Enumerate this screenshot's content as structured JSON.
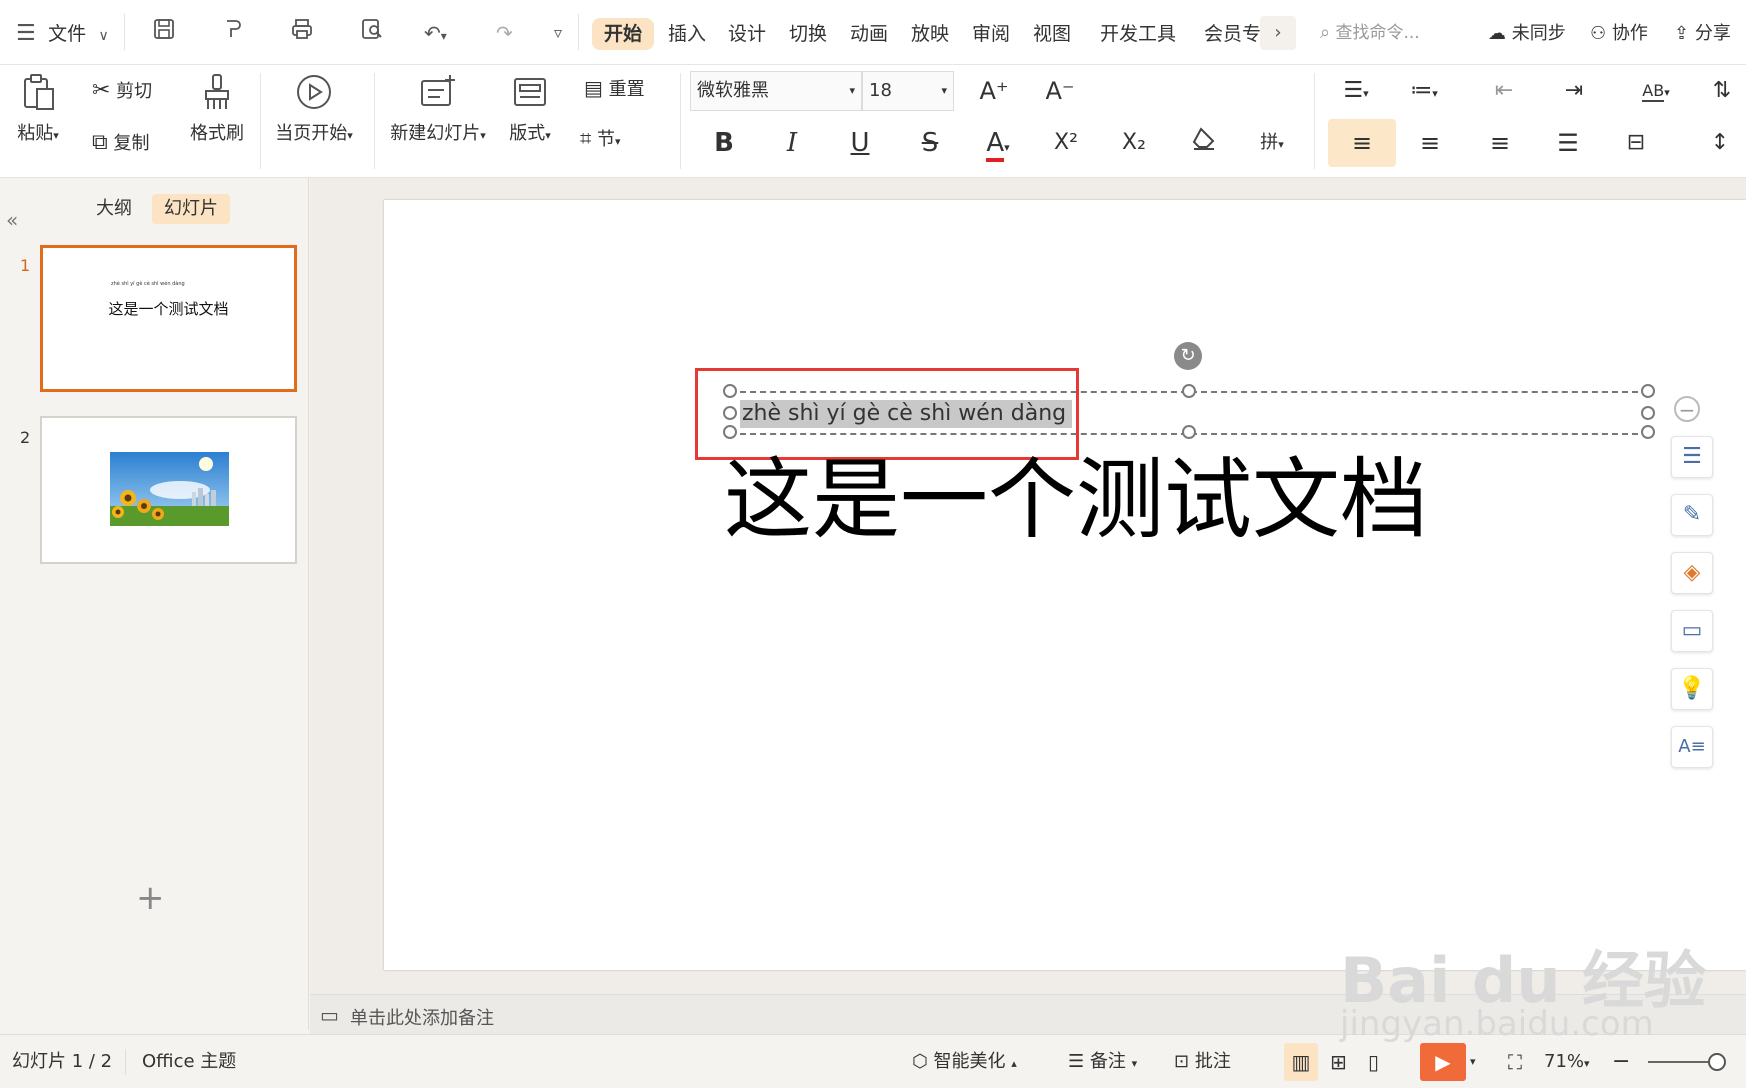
{
  "menu": {
    "file_label": "文件",
    "tabs": [
      "开始",
      "插入",
      "设计",
      "切换",
      "动画",
      "放映",
      "审阅",
      "视图",
      "开发工具",
      "会员专"
    ],
    "more": "›",
    "search_placeholder": "查找命令...",
    "sync": "未同步",
    "collab": "协作",
    "share": "分享"
  },
  "ribbon": {
    "paste": "粘贴",
    "cut": "剪切",
    "copy": "复制",
    "format_painter": "格式刷",
    "play_from_current": "当页开始",
    "new_slide": "新建幻灯片",
    "layout": "版式",
    "reset": "重置",
    "section": "节",
    "font_name": "微软雅黑",
    "font_size": "18",
    "bold": "B",
    "italic": "I",
    "underline": "U",
    "strike": "S",
    "font_color": "A",
    "superscript": "X²",
    "subscript": "X₂",
    "increase_font": "A⁺",
    "decrease_font": "A⁻",
    "font_color_accent": "#e02020",
    "highlight_bg": "#fde7c9"
  },
  "panel": {
    "tab_outline": "大纲",
    "tab_slides": "幻灯片",
    "collapse": "«",
    "slides": [
      {
        "number": "1",
        "pinyin": "zhè shì yí gè cè shì wén dàng",
        "title": "这是一个测试文档"
      },
      {
        "number": "2"
      }
    ],
    "add": "+"
  },
  "slide": {
    "pinyin": "zhè shì yí gè cè shì wén dàng",
    "title": "这是一个测试文档",
    "highlight_box_color": "#e53935"
  },
  "notes": {
    "placeholder": "单击此处添加备注"
  },
  "status": {
    "slide_counter": "幻灯片 1 / 2",
    "theme": "Office 主题",
    "beautify": "智能美化",
    "notes": "备注",
    "comments": "批注",
    "zoom": "71%"
  },
  "watermark": {
    "brand": "Bai du 经验",
    "url": "jingyan.baidu.com"
  }
}
